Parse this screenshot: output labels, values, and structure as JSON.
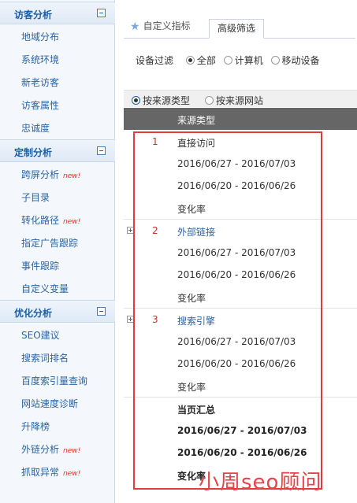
{
  "sidebar": {
    "sections": [
      {
        "title": "访客分析",
        "items": [
          {
            "label": "地域分布",
            "badge": ""
          },
          {
            "label": "系统环境",
            "badge": ""
          },
          {
            "label": "新老访客",
            "badge": ""
          },
          {
            "label": "访客属性",
            "badge": ""
          },
          {
            "label": "忠诚度",
            "badge": ""
          }
        ]
      },
      {
        "title": "定制分析",
        "items": [
          {
            "label": "跨屏分析",
            "badge": "new!"
          },
          {
            "label": "子目录",
            "badge": ""
          },
          {
            "label": "转化路径",
            "badge": "new!"
          },
          {
            "label": "指定广告跟踪",
            "badge": ""
          },
          {
            "label": "事件跟踪",
            "badge": ""
          },
          {
            "label": "自定义变量",
            "badge": ""
          }
        ]
      },
      {
        "title": "优化分析",
        "items": [
          {
            "label": "SEO建议",
            "badge": ""
          },
          {
            "label": "搜索词排名",
            "badge": ""
          },
          {
            "label": "百度索引量查询",
            "badge": ""
          },
          {
            "label": "网站速度诊断",
            "badge": ""
          },
          {
            "label": "升降榜",
            "badge": ""
          },
          {
            "label": "外链分析",
            "badge": "new!"
          },
          {
            "label": "抓取异常",
            "badge": "new!"
          }
        ]
      }
    ]
  },
  "tabs": {
    "custom_metrics": "自定义指标",
    "advanced_filter": "高级筛选"
  },
  "device_filter": {
    "label": "设备过滤",
    "options": [
      "全部",
      "计算机",
      "移动设备"
    ],
    "selected": "全部"
  },
  "segment": {
    "options": [
      "按来源类型",
      "按来源网站"
    ],
    "selected": "按来源类型"
  },
  "table": {
    "header": "来源类型",
    "groups": [
      {
        "num": "1",
        "name": "直接访问",
        "period1": "2016/06/27 - 2016/07/03",
        "period2": "2016/06/20 - 2016/06/26",
        "change": "变化率"
      },
      {
        "num": "2",
        "name": "外部链接",
        "period1": "2016/06/27 - 2016/07/03",
        "period2": "2016/06/20 - 2016/06/26",
        "change": "变化率"
      },
      {
        "num": "3",
        "name": "搜索引擎",
        "period1": "2016/06/27 - 2016/07/03",
        "period2": "2016/06/20 - 2016/06/26",
        "change": "变化率"
      }
    ],
    "summary": {
      "title": "当页汇总",
      "period1": "2016/06/27 - 2016/07/03",
      "period2": "2016/06/20 - 2016/06/26",
      "change": "变化率"
    }
  },
  "watermark": "小周seo顾问",
  "colors": {
    "accent": "#1a5fa8",
    "link": "#2a63a5",
    "badge": "#e8312a",
    "highlight_box": "#e23b3b",
    "table_header_bg": "#666666"
  }
}
